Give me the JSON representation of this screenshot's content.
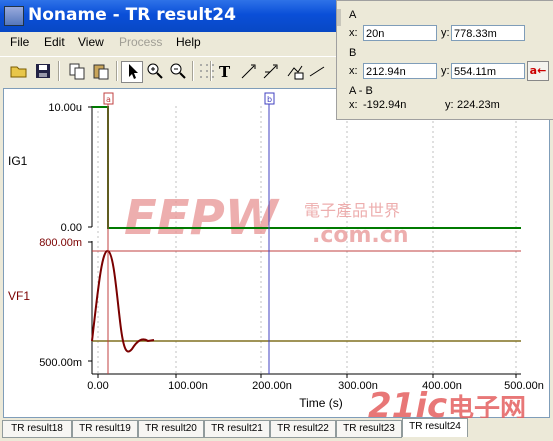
{
  "window": {
    "title": "Noname - TR result24"
  },
  "menu": {
    "file": "File",
    "edit": "Edit",
    "view": "View",
    "process": "Process",
    "help": "Help"
  },
  "toolbar": {
    "icons": [
      "open-icon",
      "save-icon",
      "copy-icon",
      "paste-icon",
      "pointer-icon",
      "zoom-in-icon",
      "zoom-out-icon",
      "grid-icon",
      "text-tool-icon",
      "cursor-a-icon",
      "cursor-b-icon",
      "fx-icon",
      "line-tool-icon"
    ]
  },
  "plot": {
    "ig1": {
      "label": "IG1",
      "ytop": "10.00u",
      "ybot": "0.00"
    },
    "vf1": {
      "label": "VF1",
      "ytop": "800.00m",
      "ybot": "500.00m"
    },
    "xticks": [
      "0.00",
      "100.00n",
      "200.00n",
      "300.00n",
      "400.00n",
      "500.00n"
    ],
    "xlabel": "Time (s)",
    "cursor_a_tag": "a",
    "cursor_b_tag": "b"
  },
  "cursors": {
    "a": {
      "header": "A",
      "x_label": "x:",
      "x": "20n",
      "y_label": "y:",
      "y": "778.33m"
    },
    "b": {
      "header": "B",
      "x_label": "x:",
      "x": "212.94n",
      "y_label": "y:",
      "y": "554.11m"
    },
    "diff": {
      "header": "A - B",
      "x_label": "x:",
      "x": "-192.94n",
      "y_label": "y:",
      "y": "224.23m"
    },
    "arrow_button": "a←"
  },
  "tabs": [
    "TR result18",
    "TR result19",
    "TR result20",
    "TR result21",
    "TR result22",
    "TR result23",
    "TR result24"
  ],
  "watermark": {
    "main": "EEPW",
    "cn": "電子產品世界",
    "url": ".com.cn",
    "site": "21ic",
    "site_cn": "电子网"
  }
}
